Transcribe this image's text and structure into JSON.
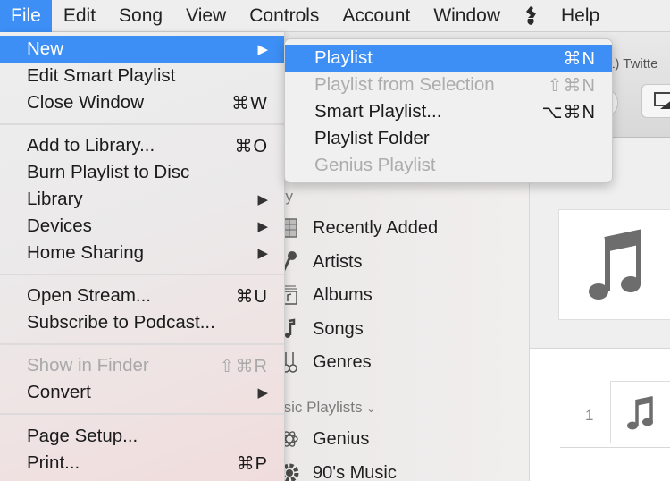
{
  "menubar": {
    "items": [
      "File",
      "Edit",
      "Song",
      "View",
      "Controls",
      "Account",
      "Window",
      "Help"
    ],
    "active": "File",
    "extra_icon": "script-menu-icon"
  },
  "file_menu": {
    "groups": [
      [
        {
          "label": "New",
          "shortcut": "",
          "submenu": true,
          "highlighted": true,
          "disabled": false
        },
        {
          "label": "Edit Smart Playlist",
          "shortcut": "",
          "submenu": false,
          "disabled": false
        },
        {
          "label": "Close Window",
          "shortcut": "⌘W",
          "submenu": false,
          "disabled": false
        }
      ],
      [
        {
          "label": "Add to Library...",
          "shortcut": "⌘O",
          "submenu": false,
          "disabled": false
        },
        {
          "label": "Burn Playlist to Disc",
          "shortcut": "",
          "submenu": false,
          "disabled": false
        },
        {
          "label": "Library",
          "shortcut": "",
          "submenu": true,
          "disabled": false
        },
        {
          "label": "Devices",
          "shortcut": "",
          "submenu": true,
          "disabled": false
        },
        {
          "label": "Home Sharing",
          "shortcut": "",
          "submenu": true,
          "disabled": false
        }
      ],
      [
        {
          "label": "Open Stream...",
          "shortcut": "⌘U",
          "submenu": false,
          "disabled": false
        },
        {
          "label": "Subscribe to Podcast...",
          "shortcut": "",
          "submenu": false,
          "disabled": false
        }
      ],
      [
        {
          "label": "Show in Finder",
          "shortcut": "⇧⌘R",
          "submenu": false,
          "disabled": true
        },
        {
          "label": "Convert",
          "shortcut": "",
          "submenu": true,
          "disabled": false
        }
      ],
      [
        {
          "label": "Page Setup...",
          "shortcut": "",
          "submenu": false,
          "disabled": false
        },
        {
          "label": "Print...",
          "shortcut": "⌘P",
          "submenu": false,
          "disabled": false
        }
      ]
    ]
  },
  "new_submenu": {
    "items": [
      {
        "label": "Playlist",
        "shortcut": "⌘N",
        "highlighted": true,
        "disabled": false
      },
      {
        "label": "Playlist from Selection",
        "shortcut": "⇧⌘N",
        "highlighted": false,
        "disabled": true
      },
      {
        "label": "Smart Playlist...",
        "shortcut": "⌥⌘N",
        "highlighted": false,
        "disabled": false
      },
      {
        "label": "Playlist Folder",
        "shortcut": "",
        "highlighted": false,
        "disabled": false
      },
      {
        "label": "Genius Playlist",
        "shortcut": "",
        "highlighted": false,
        "disabled": true
      }
    ]
  },
  "background_window": {
    "title_fragment": "1) Twitte",
    "sidebar": {
      "library_header": "Library",
      "library_items": [
        {
          "label": "Recently Added",
          "icon": "recently-added-icon"
        },
        {
          "label": "Artists",
          "icon": "microphone-icon"
        },
        {
          "label": "Albums",
          "icon": "album-icon"
        },
        {
          "label": "Songs",
          "icon": "music-note-icon"
        },
        {
          "label": "Genres",
          "icon": "guitars-icon"
        }
      ],
      "playlists_header": "Music Playlists",
      "playlist_items": [
        {
          "label": "Genius",
          "icon": "genius-atom-icon"
        },
        {
          "label": "90's Music",
          "icon": "gear-icon"
        }
      ]
    },
    "content": {
      "row_number": "1"
    }
  },
  "colors": {
    "highlight": "#3d8ff5",
    "disabled_text": "#a9a9a9"
  }
}
